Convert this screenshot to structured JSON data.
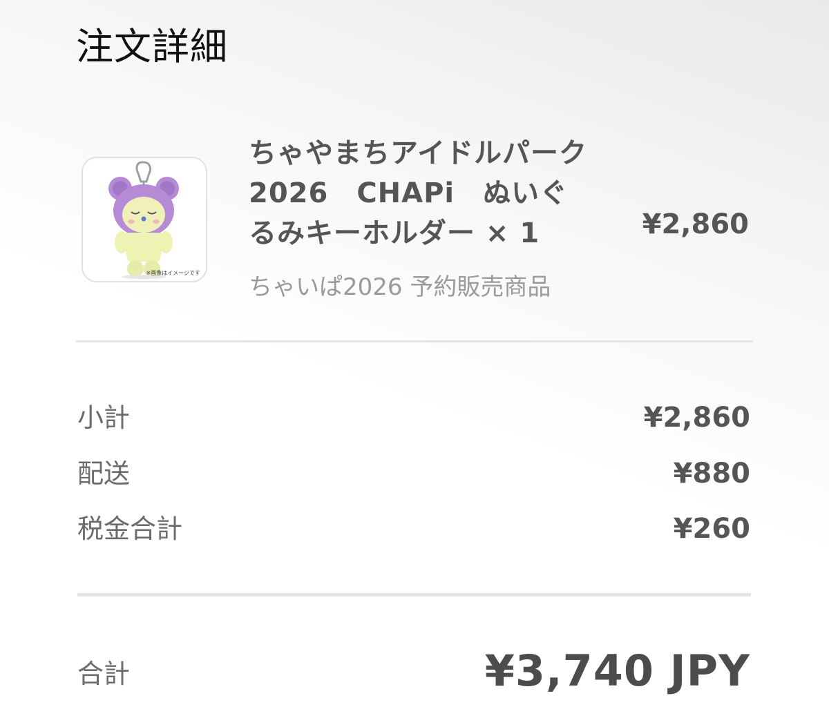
{
  "page": {
    "title": "注文詳細"
  },
  "item": {
    "name": "ちゃやまちアイドルパーク2026　CHAPi　ぬいぐるみキーホルダー × 1",
    "variant": "ちゃいぱ2026 予約販売商品",
    "price": "¥2,860",
    "image_note": "※画像はイメージです",
    "image_icon": "plush-keychain-image"
  },
  "summary": {
    "subtotal": {
      "label": "小計",
      "value": "¥2,860"
    },
    "shipping": {
      "label": "配送",
      "value": "¥880"
    },
    "tax": {
      "label": "税金合計",
      "value": "¥260"
    }
  },
  "total": {
    "label": "合計",
    "value": "¥3,740 JPY"
  },
  "colors": {
    "text_primary": "#111111",
    "text_secondary": "#555558",
    "text_muted": "#9a9a9c",
    "divider": "#e4e4e6",
    "plush_body": "#eef3b4",
    "plush_hood": "#b78ad6"
  }
}
